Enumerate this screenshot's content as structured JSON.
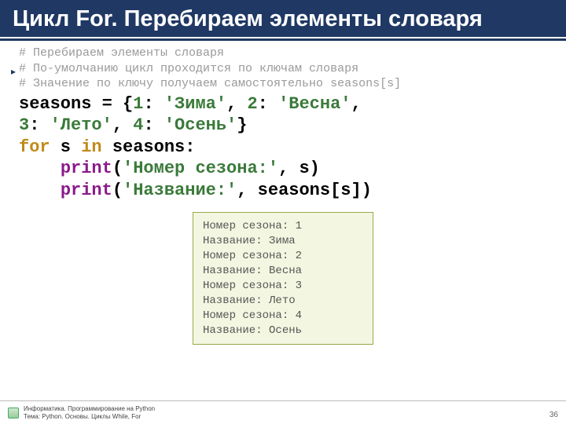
{
  "header": {
    "title": "Цикл For. Перебираем элементы словаря"
  },
  "comments": {
    "l1": "# Перебираем элементы словаря",
    "l2": "# По-умолчанию цикл проходится по ключам словаря",
    "l3": "# Значение по ключу получаем самостоятельно seasons[s]"
  },
  "code": {
    "seasons_assign": "seasons = {",
    "k1": "1",
    "c1": ": ",
    "v1": "'Зима'",
    "sep1": ", ",
    "k2": "2",
    "c2": ": ",
    "v2": "'Весна'",
    "sep2": ", ",
    "k3": "3",
    "c3": ": ",
    "v3": "'Лето'",
    "sep3": ", ",
    "k4": "4",
    "c4": ": ",
    "v4": "'Осень'",
    "close": "}",
    "for_kw": "for",
    "for_var": " s ",
    "in_kw": "in",
    "for_iter": " seasons:",
    "indent": "    ",
    "print_kw": "print",
    "print1_open": "(",
    "print1_str": "'Номер сезона:'",
    "print1_rest": ", s)",
    "print2_open": "(",
    "print2_str": "'Название:'",
    "print2_rest": ", seasons[s])"
  },
  "output": {
    "l1": "Номер сезона: 1",
    "l2": "Название: Зима",
    "l3": "Номер сезона: 2",
    "l4": "Название: Весна",
    "l5": "Номер сезона: 3",
    "l6": "Название: Лето",
    "l7": "Номер сезона: 4",
    "l8": "Название: Осень"
  },
  "footer": {
    "line1": "Информатика. Программирование на Python",
    "line2": "Тема: Python. Основы. Циклы While, For"
  },
  "page": "36"
}
